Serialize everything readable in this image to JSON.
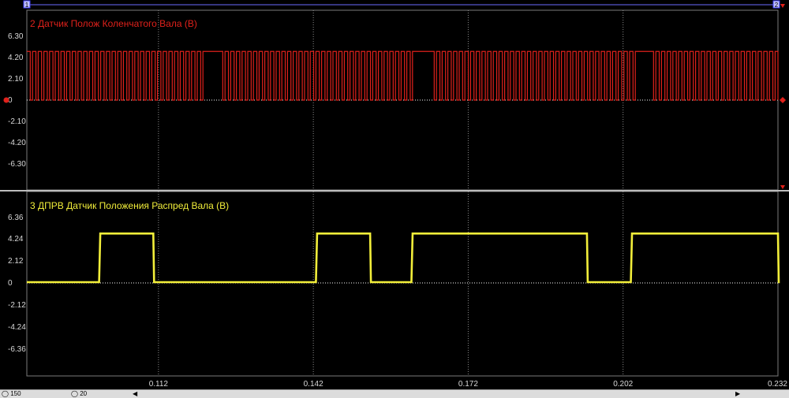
{
  "markers": {
    "left": "1",
    "right": "2"
  },
  "channel_top": {
    "title": "2 Датчик Полож Коленчатого Вала (В)",
    "color": "#e0211b",
    "y_ticks": [
      "6.30",
      "4.20",
      "2.10",
      "0",
      "-2.10",
      "-4.20",
      "-6.30"
    ]
  },
  "channel_bottom": {
    "title": "3 ДПРВ Датчик Положения Распред Вала (В)",
    "color": "#f2ee3a",
    "y_ticks": [
      "6.36",
      "4.24",
      "2.12",
      "0",
      "-2.12",
      "-4.24",
      "-6.36"
    ]
  },
  "x_axis": {
    "tick_labels": [
      "0.112",
      "0.142",
      "0.172",
      "0.202",
      "0.232"
    ]
  },
  "status": {
    "zoom": "150",
    "field2": "20"
  },
  "chart_data": [
    {
      "type": "line",
      "title": "2 Датчик Полож Коленчатого Вала (В)",
      "ylabel": "В",
      "ylim": [
        -8.4,
        8.4
      ],
      "series": [
        {
          "name": "2 Датчик Полож Коленчатого Вала (В)",
          "pattern": "square pulse train, high 4.8 V, low 0 V, missing-tooth gaps",
          "high": 4.8,
          "low": 0.0
        }
      ]
    },
    {
      "type": "line",
      "title": "3 ДПРВ Датчик Положения Распред Вала (В)",
      "ylabel": "В",
      "ylim": [
        -8.48,
        8.48
      ],
      "x_ticks": [
        0.112,
        0.142,
        0.172,
        0.202,
        0.232
      ],
      "series": [
        {
          "name": "3 ДПРВ Датчик Положения Распред Вала (В)",
          "high": 4.8,
          "low": 0.0,
          "high_intervals": [
            [
              0.1005,
              0.111
            ],
            [
              0.1425,
              0.153
            ],
            [
              0.161,
              0.195
            ],
            [
              0.2035,
              0.2375
            ]
          ]
        }
      ]
    }
  ]
}
